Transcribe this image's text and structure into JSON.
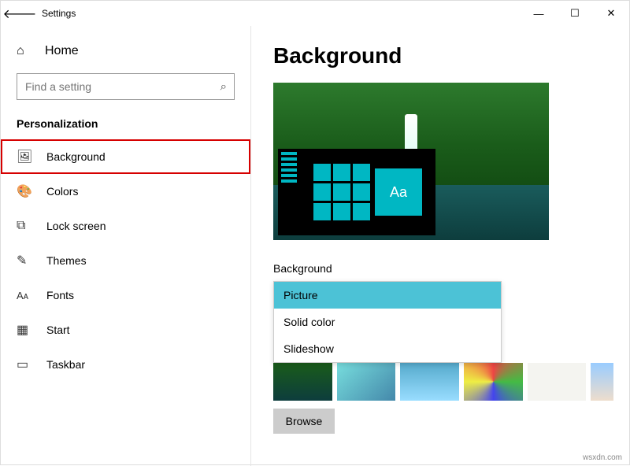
{
  "titlebar": {
    "title": "Settings"
  },
  "sidebar": {
    "home_label": "Home",
    "search_placeholder": "Find a setting",
    "section_title": "Personalization",
    "items": [
      {
        "label": "Background",
        "selected": true
      },
      {
        "label": "Colors"
      },
      {
        "label": "Lock screen"
      },
      {
        "label": "Themes"
      },
      {
        "label": "Fonts"
      },
      {
        "label": "Start"
      },
      {
        "label": "Taskbar"
      }
    ]
  },
  "main": {
    "heading": "Background",
    "preview_text": "Aa",
    "field_label": "Background",
    "dropdown": {
      "options": [
        {
          "label": "Picture",
          "selected": true
        },
        {
          "label": "Solid color"
        },
        {
          "label": "Slideshow"
        }
      ]
    },
    "browse_label": "Browse"
  },
  "watermark": "wsxdn.com"
}
